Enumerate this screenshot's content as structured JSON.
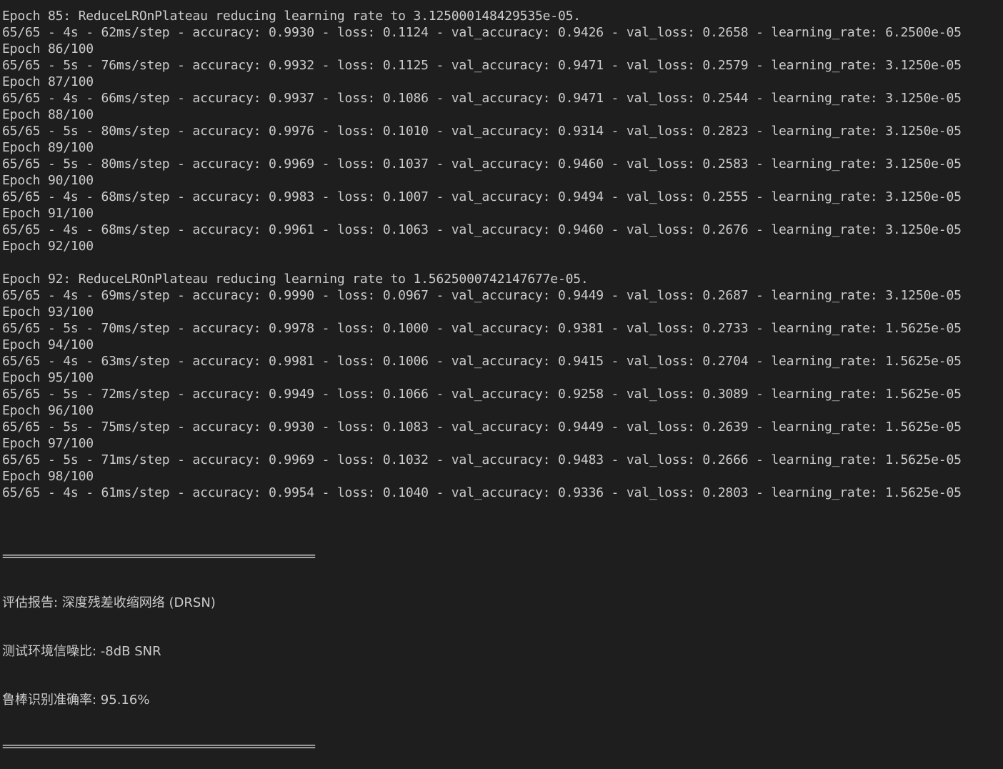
{
  "window": {
    "background": "#1e1e1e",
    "foreground": "#cccccc"
  },
  "log_lines": [
    "Epoch 85: ReduceLROnPlateau reducing learning rate to 3.125000148429535e-05.",
    "65/65 - 4s - 62ms/step - accuracy: 0.9930 - loss: 0.1124 - val_accuracy: 0.9426 - val_loss: 0.2658 - learning_rate: 6.2500e-05",
    "Epoch 86/100",
    "65/65 - 5s - 76ms/step - accuracy: 0.9932 - loss: 0.1125 - val_accuracy: 0.9471 - val_loss: 0.2579 - learning_rate: 3.1250e-05",
    "Epoch 87/100",
    "65/65 - 4s - 66ms/step - accuracy: 0.9937 - loss: 0.1086 - val_accuracy: 0.9471 - val_loss: 0.2544 - learning_rate: 3.1250e-05",
    "Epoch 88/100",
    "65/65 - 5s - 80ms/step - accuracy: 0.9976 - loss: 0.1010 - val_accuracy: 0.9314 - val_loss: 0.2823 - learning_rate: 3.1250e-05",
    "Epoch 89/100",
    "65/65 - 5s - 80ms/step - accuracy: 0.9969 - loss: 0.1037 - val_accuracy: 0.9460 - val_loss: 0.2583 - learning_rate: 3.1250e-05",
    "Epoch 90/100",
    "65/65 - 4s - 68ms/step - accuracy: 0.9983 - loss: 0.1007 - val_accuracy: 0.9494 - val_loss: 0.2555 - learning_rate: 3.1250e-05",
    "Epoch 91/100",
    "65/65 - 4s - 68ms/step - accuracy: 0.9961 - loss: 0.1063 - val_accuracy: 0.9460 - val_loss: 0.2676 - learning_rate: 3.1250e-05",
    "Epoch 92/100",
    "",
    "Epoch 92: ReduceLROnPlateau reducing learning rate to 1.5625000742147677e-05.",
    "65/65 - 4s - 69ms/step - accuracy: 0.9990 - loss: 0.0967 - val_accuracy: 0.9449 - val_loss: 0.2687 - learning_rate: 3.1250e-05",
    "Epoch 93/100",
    "65/65 - 5s - 70ms/step - accuracy: 0.9978 - loss: 0.1000 - val_accuracy: 0.9381 - val_loss: 0.2733 - learning_rate: 1.5625e-05",
    "Epoch 94/100",
    "65/65 - 4s - 63ms/step - accuracy: 0.9981 - loss: 0.1006 - val_accuracy: 0.9415 - val_loss: 0.2704 - learning_rate: 1.5625e-05",
    "Epoch 95/100",
    "65/65 - 5s - 72ms/step - accuracy: 0.9949 - loss: 0.1066 - val_accuracy: 0.9258 - val_loss: 0.3089 - learning_rate: 1.5625e-05",
    "Epoch 96/100",
    "65/65 - 5s - 75ms/step - accuracy: 0.9930 - loss: 0.1083 - val_accuracy: 0.9449 - val_loss: 0.2639 - learning_rate: 1.5625e-05",
    "Epoch 97/100",
    "65/65 - 5s - 71ms/step - accuracy: 0.9969 - loss: 0.1032 - val_accuracy: 0.9483 - val_loss: 0.2666 - learning_rate: 1.5625e-05",
    "Epoch 98/100",
    "65/65 - 4s - 61ms/step - accuracy: 0.9954 - loss: 0.1040 - val_accuracy: 0.9336 - val_loss: 0.2803 - learning_rate: 1.5625e-05"
  ],
  "report": {
    "separator_top": "==================================================",
    "title": "评估报告: 深度残差收缩网络 (DRSN)",
    "snr_line": "测试环境信噪比: -8dB SNR",
    "accuracy_line": "鲁棒识别准确率: 95.16%",
    "separator_bottom": "=================================================="
  }
}
